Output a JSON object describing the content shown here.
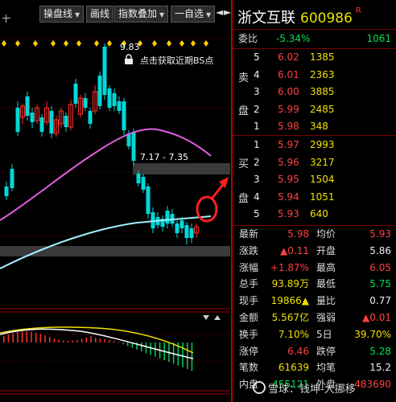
{
  "toolbar": {
    "btn1": "操盘线",
    "btn2": "画线",
    "btn3": "指数叠加",
    "btn4": "一自选"
  },
  "chart": {
    "high_label": "9.83",
    "bs_hint": "点击获取近期BS点",
    "gap_label": "7.17 - 7.35",
    "colors": {
      "up": "#ff3030",
      "down": "#00d8d8",
      "ma_pink": "#e060e0",
      "ma_cyan": "#a0f0ff"
    }
  },
  "stock": {
    "name": "浙文互联",
    "code": "600986",
    "mark": "R"
  },
  "weibi": {
    "label": "委比",
    "pct": "-5.34%",
    "diff": "1061"
  },
  "sell": {
    "side_chars": [
      "卖",
      "盘"
    ],
    "levels": [
      {
        "n": "5",
        "price": "6.02",
        "vol": "1385"
      },
      {
        "n": "4",
        "price": "6.01",
        "vol": "2363"
      },
      {
        "n": "3",
        "price": "6.00",
        "vol": "3885"
      },
      {
        "n": "2",
        "price": "5.99",
        "vol": "2485"
      },
      {
        "n": "1",
        "price": "5.98",
        "vol": "348"
      }
    ]
  },
  "buy": {
    "side_chars": [
      "买",
      "盘"
    ],
    "levels": [
      {
        "n": "1",
        "price": "5.97",
        "vol": "2993"
      },
      {
        "n": "2",
        "price": "5.96",
        "vol": "3217"
      },
      {
        "n": "3",
        "price": "5.95",
        "vol": "1504"
      },
      {
        "n": "4",
        "price": "5.94",
        "vol": "1051"
      },
      {
        "n": "5",
        "price": "5.93",
        "vol": "640"
      }
    ]
  },
  "stats": [
    {
      "l1": "最新",
      "v1": "5.98",
      "c1": "red",
      "l2": "均价",
      "v2": "5.93",
      "c2": "red"
    },
    {
      "l1": "涨跌",
      "v1": "▲0.11",
      "c1": "red",
      "l2": "开盘",
      "v2": "5.86",
      "c2": "white"
    },
    {
      "l1": "涨幅",
      "v1": "+1.87%",
      "c1": "red",
      "l2": "最高",
      "v2": "6.05",
      "c2": "red"
    },
    {
      "l1": "总手",
      "v1": "93.89万",
      "c1": "yellow",
      "l2": "最低",
      "v2": "5.75",
      "c2": "green"
    },
    {
      "l1": "现手",
      "v1": "19866▲",
      "c1": "yellow",
      "l2": "量比",
      "v2": "0.77",
      "c2": "white"
    },
    {
      "l1": "金额",
      "v1": "5.567亿",
      "c1": "yellow",
      "l2": "强弱",
      "v2": "▲0.01",
      "c2": "red"
    },
    {
      "l1": "换手",
      "v1": "7.10%",
      "c1": "yellow",
      "l2": "5日",
      "v2": "39.70%",
      "c2": "yellow"
    },
    {
      "l1": "涨停",
      "v1": "6.46",
      "c1": "red",
      "l2": "跌停",
      "v2": "5.28",
      "c2": "green"
    },
    {
      "l1": "笔数",
      "v1": "61639",
      "c1": "yellow",
      "l2": "均笔",
      "v2": "15.2",
      "c2": "white"
    },
    {
      "l1": "内盘",
      "v1": "455121",
      "c1": "green",
      "l2": "外盘",
      "v2": "483690",
      "c2": "red"
    }
  ],
  "watermark": "雪球：钱坤-大挪移"
}
